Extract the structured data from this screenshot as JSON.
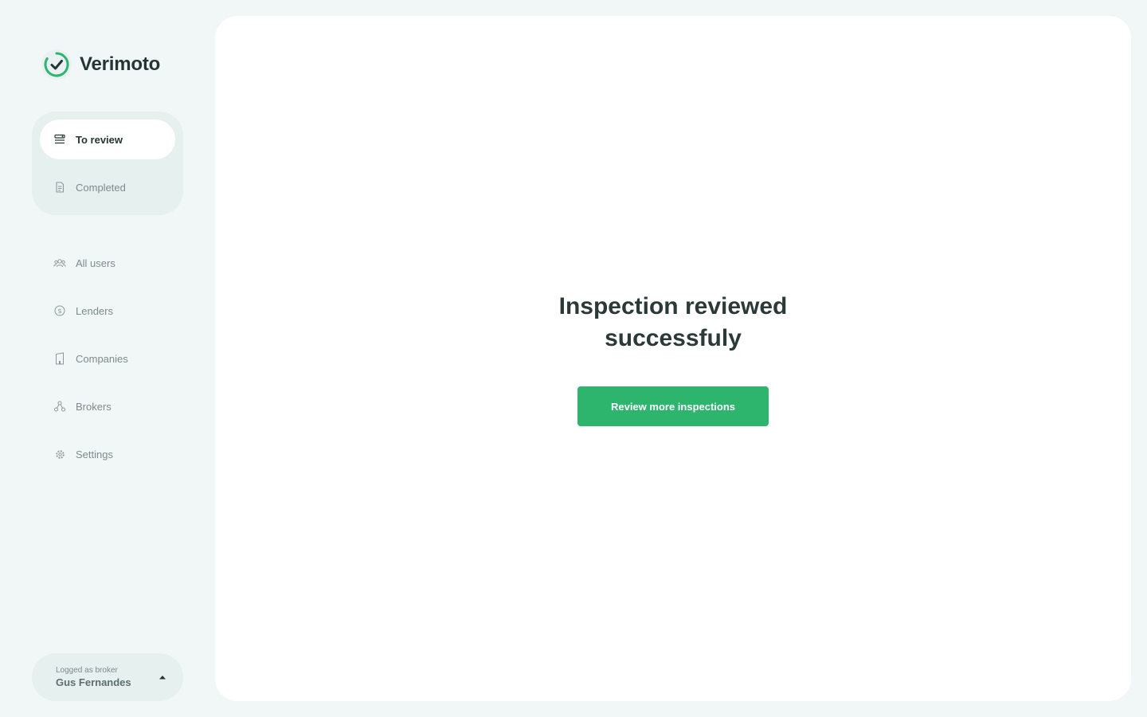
{
  "brand": {
    "name": "Verimoto",
    "icon": "check-circle-icon",
    "accent": "#2db56e"
  },
  "nav_primary": [
    {
      "label": "To review",
      "icon": "inbox-stack-icon",
      "active": true
    },
    {
      "label": "Completed",
      "icon": "document-icon",
      "active": false
    }
  ],
  "nav_secondary": [
    {
      "label": "All users",
      "icon": "users-group-icon"
    },
    {
      "label": "Lenders",
      "icon": "dollar-circle-icon"
    },
    {
      "label": "Companies",
      "icon": "building-icon"
    },
    {
      "label": "Brokers",
      "icon": "network-nodes-icon"
    },
    {
      "label": "Settings",
      "icon": "gear-icon"
    }
  ],
  "user": {
    "role": "Logged as broker",
    "name": "Gus Fernandes",
    "toggle_icon": "caret-up-icon"
  },
  "main": {
    "title_line1": "Inspection reviewed",
    "title_line2": "successfuly",
    "cta_label": "Review more inspections",
    "cta_color": "#2db56e"
  }
}
